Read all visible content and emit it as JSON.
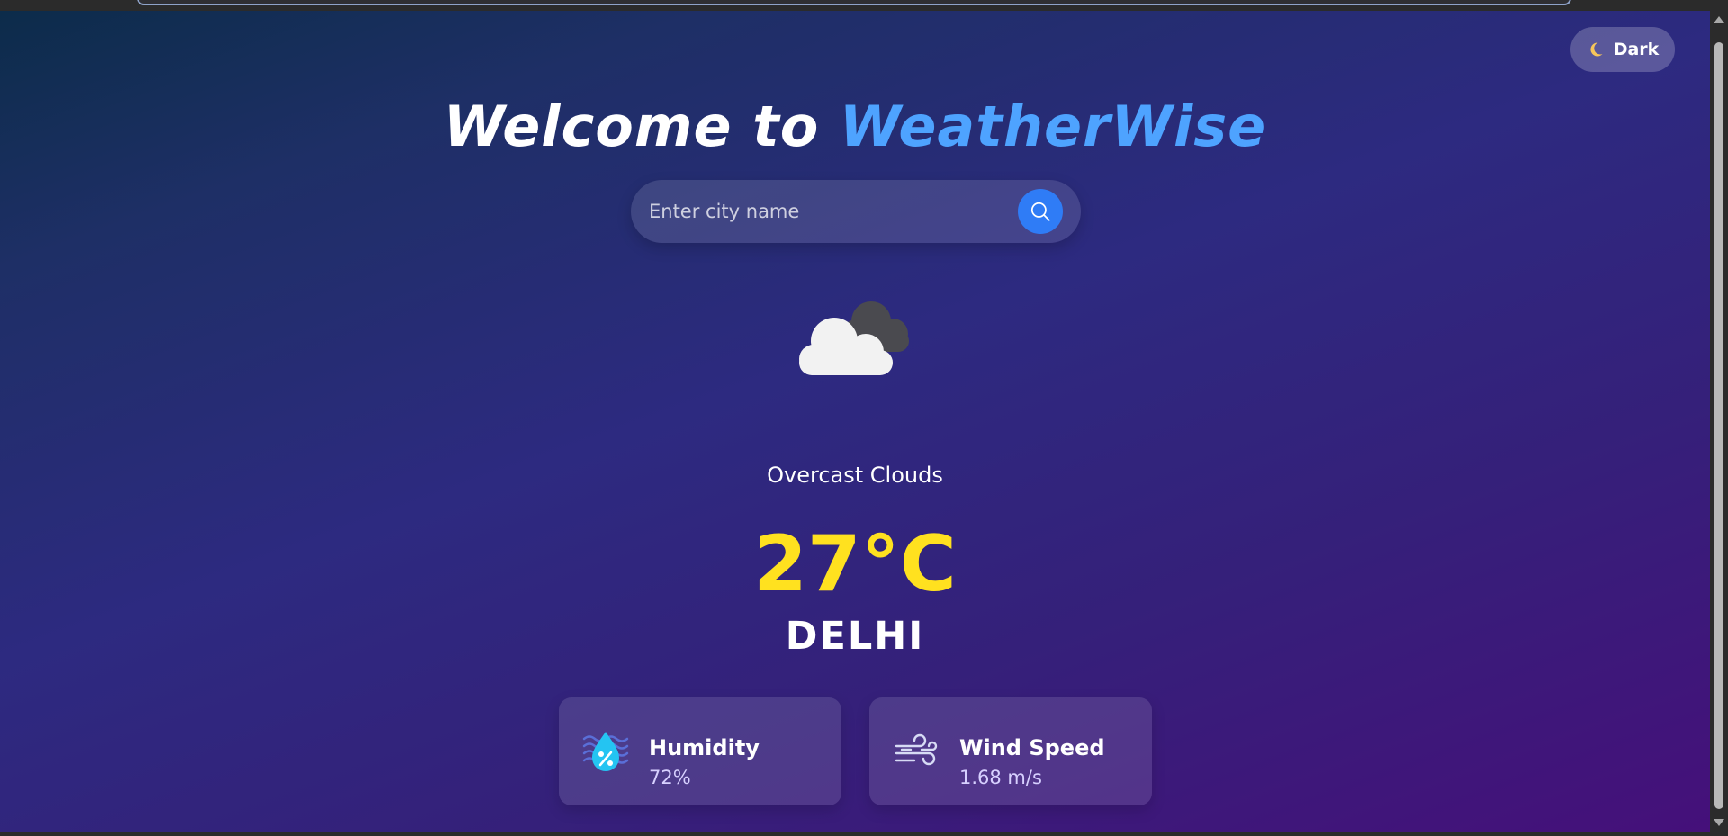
{
  "theme_toggle": {
    "icon": "moon-icon",
    "label": "Dark"
  },
  "header": {
    "title_prefix": "Welcome to",
    "title_brand": "WeatherWise"
  },
  "search": {
    "placeholder": "Enter city name",
    "value": "",
    "button_icon": "search-icon"
  },
  "weather": {
    "icon": "overcast-clouds-icon",
    "description": "Overcast Clouds",
    "temperature": "27°C",
    "city": "DELHI"
  },
  "stats": {
    "humidity": {
      "icon": "humidity-icon",
      "label": "Humidity",
      "value": "72%"
    },
    "wind": {
      "icon": "wind-icon",
      "label": "Wind Speed",
      "value": "1.68 m/s"
    }
  },
  "colors": {
    "brand": "#4ea3ff",
    "temperature": "#ffe11f",
    "search_button": "#2f7cf6"
  }
}
